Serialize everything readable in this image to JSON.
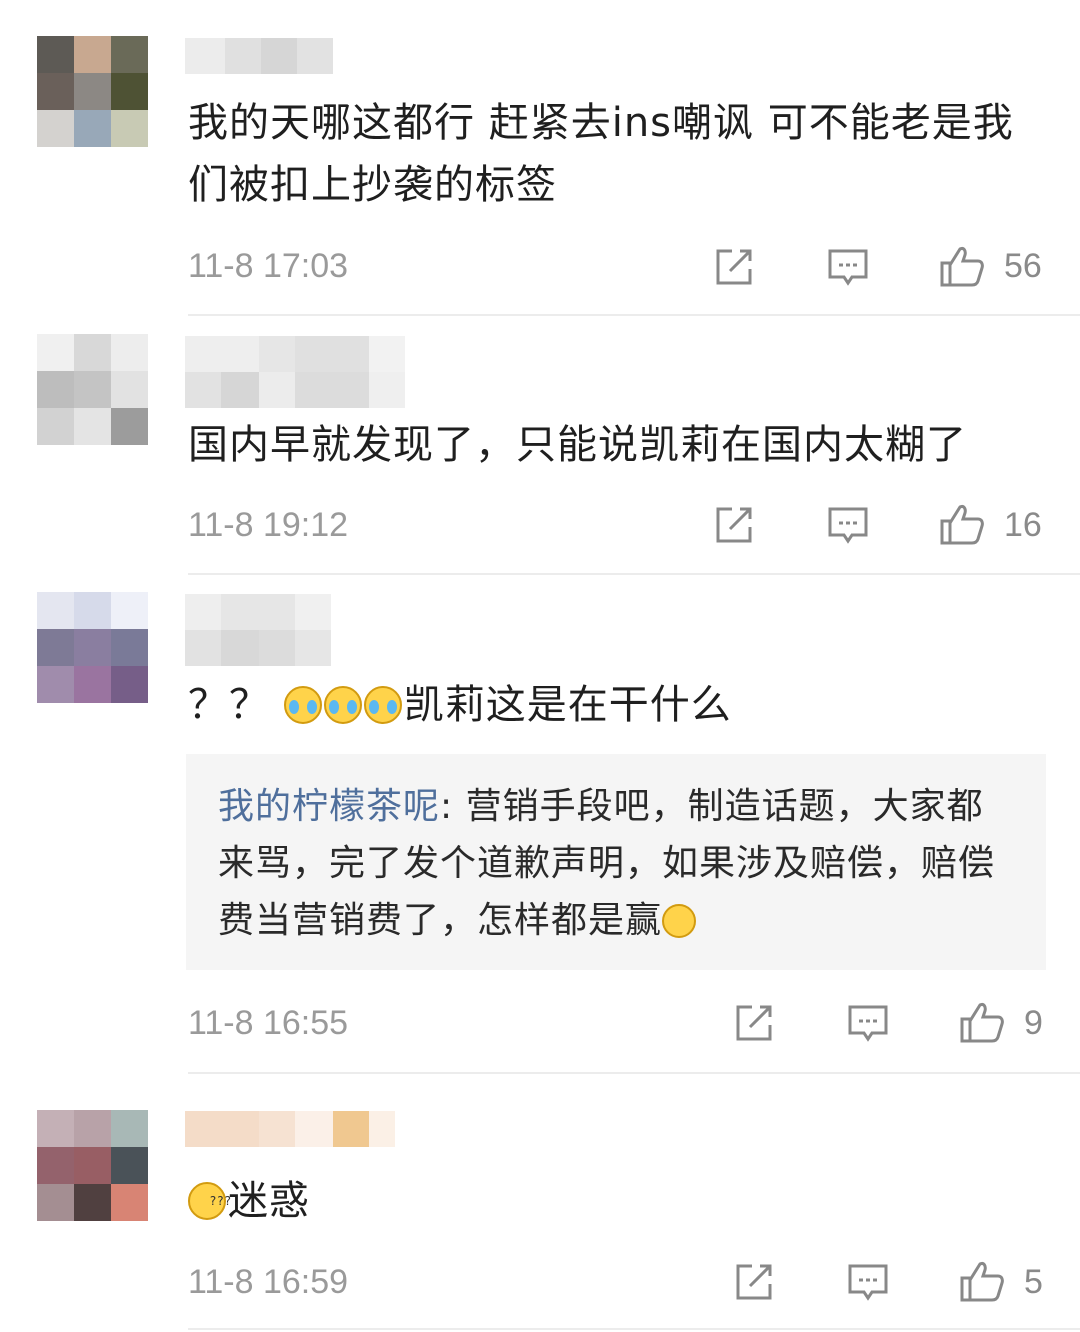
{
  "comments": [
    {
      "text": "我的天哪这都行 赶紧去ins嘲讽 可不能老是我们被扣上抄袭的标签",
      "time": "11-8 17:03",
      "likes": "56"
    },
    {
      "text": "国内早就发现了，只能说凯莉在国内太糊了",
      "time": "11-8 19:12",
      "likes": "16"
    },
    {
      "text_prefix": "？？",
      "text_suffix": "凯莉这是在干什么",
      "emoji": "cry-laugh-icon",
      "reply": {
        "author": "我的柠檬茶呢",
        "text": ": 营销手段吧，制造话题，大家都来骂，完了发个道歉声明，如果涉及赔偿，赔偿费当营销费了，怎样都是赢"
      },
      "time": "11-8 16:55",
      "likes": "9"
    },
    {
      "text": "迷惑",
      "emoji": "confused-icon",
      "time": "11-8 16:59",
      "likes": "5"
    }
  ],
  "colors": {
    "meta": "#9a9a9a",
    "reply_author": "#4f6f9c",
    "reply_bg": "#f5f5f5"
  }
}
